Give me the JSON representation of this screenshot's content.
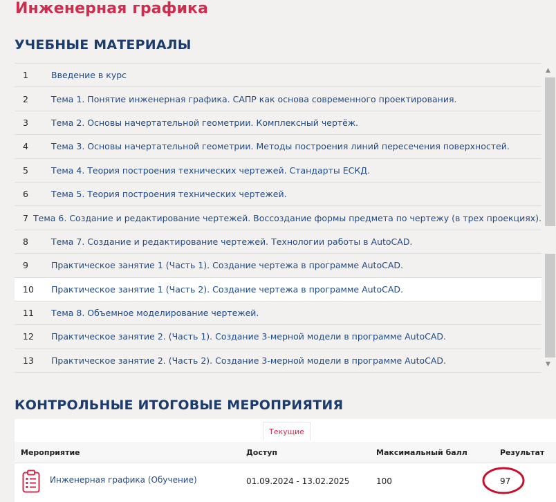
{
  "page": {
    "title": "Инженерная графика"
  },
  "materials": {
    "heading": "УЧЕБНЫЕ МАТЕРИАЛЫ",
    "items": [
      {
        "num": "1",
        "label": "Введение в курс"
      },
      {
        "num": "2",
        "label": "Тема 1. Понятие инженерная графика. САПР как основа современного проектирования."
      },
      {
        "num": "3",
        "label": "Тема 2. Основы начертательной геометрии. Комплексный чертёж."
      },
      {
        "num": "4",
        "label": "Тема 3. Основы начертательной геометрии. Методы построения линий пересечения поверхностей."
      },
      {
        "num": "5",
        "label": "Тема 4. Теория построения технических чертежей. Стандарты ЕСКД."
      },
      {
        "num": "6",
        "label": "Тема 5. Теория построения технических чертежей."
      },
      {
        "num": "7",
        "label": "Тема 6. Создание и редактирование чертежей. Воссоздание формы предмета по чертежу (в трех проекциях)."
      },
      {
        "num": "8",
        "label": "Тема 7. Создание и редактирование чертежей. Технологии работы в AutoCAD."
      },
      {
        "num": "9",
        "label": "Практическое занятие 1 (Часть 1). Создание чертежа в программе AutoCAD."
      },
      {
        "num": "10",
        "label": "Практическое занятие 1 (Часть 2). Создание чертежа в программе AutoCAD."
      },
      {
        "num": "11",
        "label": "Тема 8. Объемное моделирование чертежей."
      },
      {
        "num": "12",
        "label": "Практическое занятие 2. (Часть 1). Создание 3-мерной модели в программе AutoCAD."
      },
      {
        "num": "13",
        "label": "Практическое занятие 2. (Часть 2). Создание 3-мерной модели в программе AutoCAD."
      }
    ]
  },
  "events": {
    "heading": "КОНТРОЛЬНЫЕ ИТОГОВЫЕ МЕРОПРИЯТИЯ",
    "tab_label": "Текущие",
    "columns": {
      "event": "Мероприятие",
      "access": "Доступ",
      "max_score": "Максимальный балл",
      "result": "Результат"
    },
    "rows": [
      {
        "name": "Инженерная графика (Обучение)",
        "access": "01.09.2024 - 13.02.2025",
        "max_score": "100",
        "result": "97",
        "icon": "clipboard-list-icon"
      }
    ]
  },
  "colors": {
    "title": "#cf2d4e",
    "heading": "#1d3c6e",
    "link": "#1f4a87",
    "highlight_oval": "#c8102e"
  }
}
